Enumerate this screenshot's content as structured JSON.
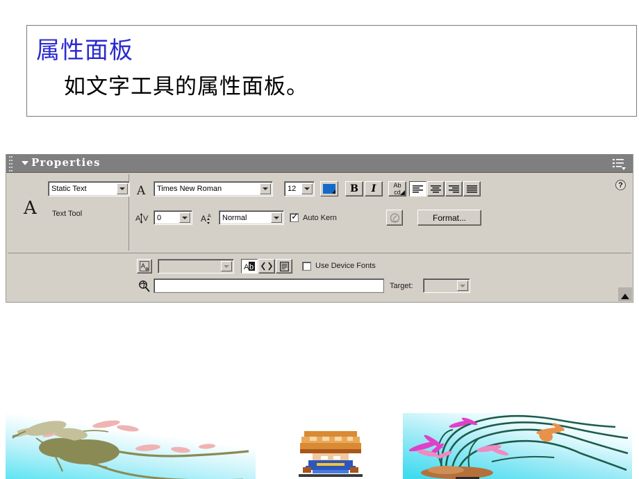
{
  "slide": {
    "heading": "属性面板",
    "subheading": "如文字工具的属性面板。",
    "heading_color": "#2a2ad0",
    "subheading_color": "#000000"
  },
  "panel": {
    "title": "Properties",
    "titlebar_color": "#7f7f7f",
    "body_color": "#d4d0c8",
    "collapse_arrow": "collapse-triangle",
    "menu_icon": "panel-options-icon",
    "help_label": "?",
    "expand_label": "expand-triangle"
  },
  "tool": {
    "glyph": "A",
    "type_value": "Static Text",
    "label": "Text Tool"
  },
  "character": {
    "font_icon": "A",
    "font_value": "Times New Roman",
    "size_value": "12",
    "color_value": "#1569c7",
    "color_name": "text-color-blue",
    "bold_label": "B",
    "italic_label": "I",
    "direction_label_top": "Ab",
    "direction_label_bottom": "cd",
    "align_left": "align-left",
    "align_center": "align-center",
    "align_right": "align-right",
    "align_justify": "align-justify",
    "align_active": "align-left"
  },
  "spacing": {
    "tracking_icon": "AV",
    "tracking_value": "0",
    "position_icon": "A",
    "position_value": "Normal",
    "autokern_label": "Auto Kern",
    "autokern_checked": true,
    "selectable_icon": "anchor-icon",
    "format_label": "Format..."
  },
  "instance": {
    "var_icon": "A",
    "var_value": "",
    "btn_ab": "Ab",
    "btn_code": "<>",
    "btn_render": "render-as-html-icon",
    "device_fonts_label": "Use Device Fonts",
    "device_fonts_checked": false
  },
  "link": {
    "url_icon": "link-icon",
    "url_value": "",
    "target_label": "Target:",
    "target_value": ""
  },
  "decoration": {
    "left_art": "plum-blossom-branch",
    "mid_art": "pixel-character-sprite",
    "right_art": "orchid-grass-flowers"
  }
}
